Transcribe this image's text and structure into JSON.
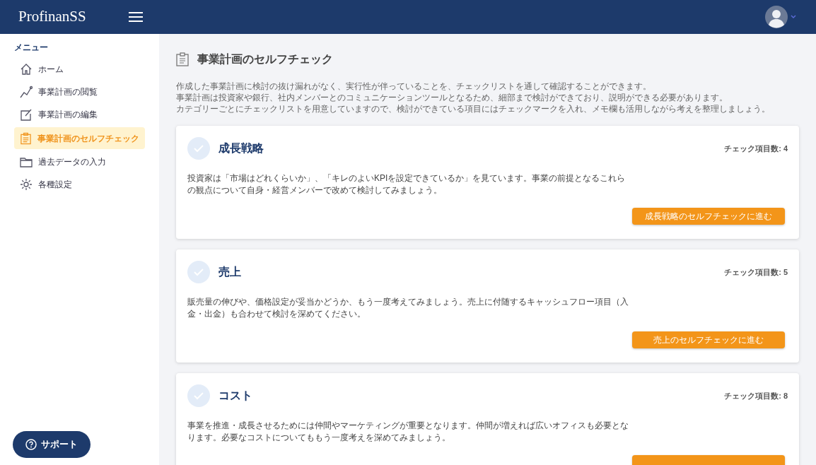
{
  "header": {
    "logo": "ProfinanSS"
  },
  "sidebar": {
    "heading": "メニュー",
    "items": [
      {
        "label": "ホーム",
        "selected": false
      },
      {
        "label": "事業計画の閲覧",
        "selected": false
      },
      {
        "label": "事業計画の編集",
        "selected": false
      },
      {
        "label": "事業計画のセルフチェック",
        "selected": true
      },
      {
        "label": "過去データの入力",
        "selected": false
      },
      {
        "label": "各種設定",
        "selected": false
      }
    ],
    "support_button": "サポート"
  },
  "page": {
    "title": "事業計画のセルフチェック",
    "description": [
      "作成した事業計画に検討の抜け漏れがなく、実行性が伴っていることを、チェックリストを通して確認することができます。",
      "事業計画は投資家や銀行、社内メンバーとのコミュニケーションツールとなるため、細部まで検討ができており、説明ができる必要があります。",
      "カテゴリーごとにチェックリストを用意していますので、検討ができている項目にはチェックマークを入れ、メモ欄も活用しながら考えを整理しましょう。"
    ]
  },
  "cards": [
    {
      "title": "成長戦略",
      "count": "チェック項目数: 4",
      "text": "投資家は「市場はどれくらいか」、「キレのよいKPIを設定できているか」を見ています。事業の前提となるこれらの観点について自身・経営メンバーで改めて検討してみましょう。",
      "button": "成長戦略のセルフチェックに進む"
    },
    {
      "title": "売上",
      "count": "チェック項目数: 5",
      "text": "販売量の伸びや、価格設定が妥当かどうか、もう一度考えてみましょう。売上に付随するキャッシュフロー項目（入金・出金）も合わせて検討を深めてください。",
      "button": "売上のセルフチェックに進む"
    },
    {
      "title": "コスト",
      "count": "チェック項目数: 8",
      "text": "事業を推進・成長させるためには仲間やマーケティングが重要となります。仲間が増えれば広いオフィスも必要となります。必要なコストについてももう一度考えを深めてみましょう。"
    }
  ]
}
